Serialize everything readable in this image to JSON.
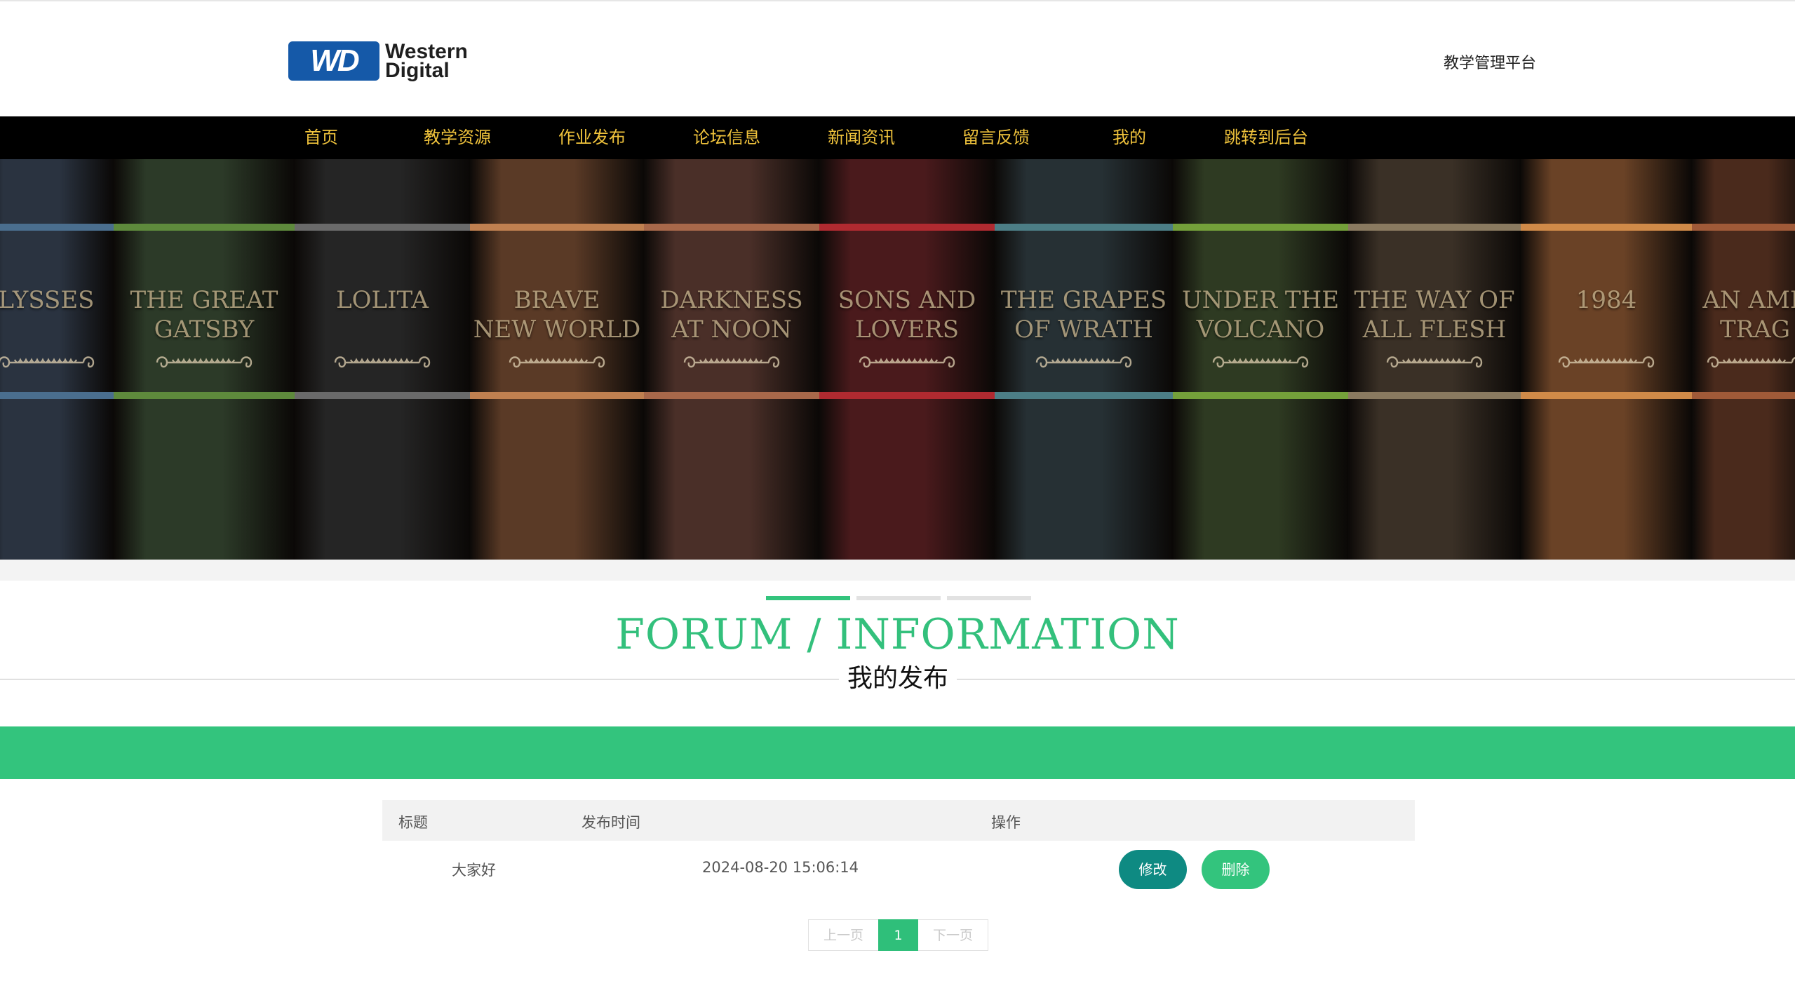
{
  "header": {
    "logo_text_line1": "Western",
    "logo_text_line2": "Digital",
    "logo_badge": "WD",
    "platform_title": "教学管理平台"
  },
  "nav": {
    "items": [
      {
        "label": "首页"
      },
      {
        "label": "教学资源"
      },
      {
        "label": "作业发布"
      },
      {
        "label": "论坛信息"
      },
      {
        "label": "新闻资讯"
      },
      {
        "label": "留言反馈"
      },
      {
        "label": "我的"
      },
      {
        "label": "跳转到后台"
      }
    ]
  },
  "banner": {
    "books": [
      {
        "title": "LYSSES",
        "color": "#2a3340",
        "band": "#4a6e8e"
      },
      {
        "title": "THE GREAT\nGATSBY",
        "color": "#2c3a28",
        "band": "#5e8a3c"
      },
      {
        "title": "LOLITA",
        "color": "#252525",
        "band": "#6a6a6a"
      },
      {
        "title": "BRAVE\nNEW WORLD",
        "color": "#5a3a26",
        "band": "#c08050"
      },
      {
        "title": "DARKNESS\nAT NOON",
        "color": "#4a2f28",
        "band": "#a8684a"
      },
      {
        "title": "SONS AND\nLOVERS",
        "color": "#4a1a1c",
        "band": "#b02a30"
      },
      {
        "title": "THE GRAPES\nOF WRATH",
        "color": "#263034",
        "band": "#4c7e86"
      },
      {
        "title": "UNDER THE\nVOLCANO",
        "color": "#2e3a22",
        "band": "#74a03a"
      },
      {
        "title": "THE WAY OF\nALL FLESH",
        "color": "#3a3026",
        "band": "#8a7a60"
      },
      {
        "title": "1984",
        "color": "#6a4226",
        "band": "#d08a48"
      },
      {
        "title": "AN AME\nTRAG",
        "color": "#4a2a1c",
        "band": "#a05a38"
      }
    ]
  },
  "section": {
    "title_en": "FORUM / INFORMATION",
    "title_cn": "我的发布"
  },
  "table": {
    "headers": [
      "标题",
      "发布时间",
      "操作"
    ],
    "rows": [
      {
        "title": "大家好",
        "time": "2024-08-20 15:06:14"
      }
    ],
    "edit_label": "修改",
    "delete_label": "删除"
  },
  "pagination": {
    "prev_label": "上一页",
    "current_page": "1",
    "next_label": "下一页"
  },
  "colors": {
    "accent": "#33c47d",
    "nav_text": "#f0c33c",
    "edit_button": "#0e8a82"
  }
}
